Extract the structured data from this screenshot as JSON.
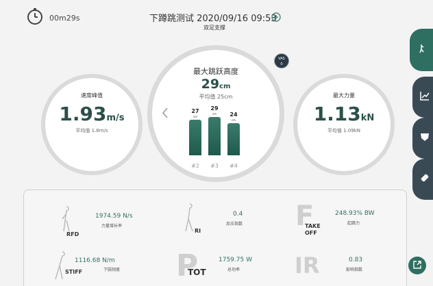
{
  "header": {
    "timer": "00m29s",
    "title": "下蹲跳测试 2020/09/16 09:53",
    "subtitle": "双足支撑"
  },
  "gauges": {
    "left": {
      "label": "速度峰值",
      "value": "1.93",
      "unit": "m/s",
      "avg": "平均值 1.8m/s"
    },
    "center": {
      "label": "最大跳跃高度",
      "value": "29",
      "unit": "cm",
      "avg": "平均值 25cm",
      "vas_line1": "VAS",
      "vas_line2": "0"
    },
    "right": {
      "label": "最大力量",
      "value": "1.13",
      "unit": "kN",
      "avg": "平均值 1.09kN"
    }
  },
  "chart_data": {
    "type": "bar",
    "categories": [
      "#2",
      "#3",
      "#4"
    ],
    "values": [
      27,
      29,
      24
    ],
    "value_unit": "cm",
    "ylim": [
      0,
      32
    ]
  },
  "metrics": {
    "rfd": {
      "code": "RFD",
      "value": "1974.59 N/s",
      "label": "力量增长率"
    },
    "ri": {
      "code": "RI",
      "value": "0.4",
      "label": "反应指数"
    },
    "takeoff": {
      "code_line1": "TAKE",
      "code_line2": "OFF",
      "letter": "F",
      "value": "248.93% BW",
      "label": "起跳力"
    },
    "stiff": {
      "code": "STIFF",
      "value": "1116.68 N/m",
      "label": "下肢刚度"
    },
    "ptot": {
      "letter": "P",
      "code": "TOT",
      "value": "1759.75 W",
      "label": "总功率"
    },
    "ir": {
      "letter": "IR",
      "value": "0.83",
      "label": "影响指数"
    }
  },
  "colors": {
    "accent": "#2f6f62",
    "bar": "#2b6a5b",
    "rail_dark": "#3a4a55"
  },
  "icons": {
    "timer": "stopwatch-icon",
    "add": "plus-circle-icon",
    "rail": [
      "jump-icon",
      "line-chart-icon",
      "shield-icon",
      "dumbbell-icon"
    ],
    "fab": "export-icon"
  }
}
